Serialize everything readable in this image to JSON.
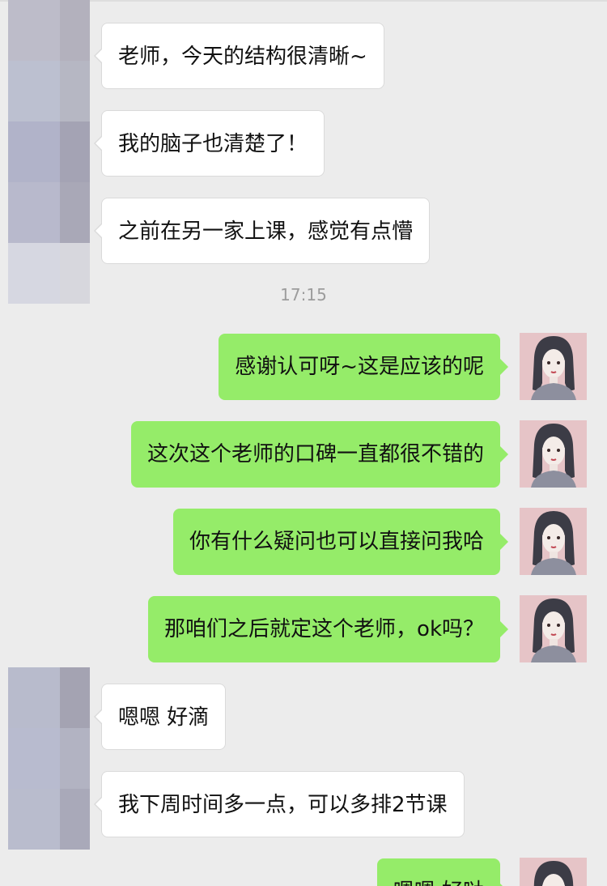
{
  "colors": {
    "background": "#ececec",
    "incoming_bubble": "#ffffff",
    "outgoing_bubble": "#95ec69",
    "timestamp_text": "#9c9c9c"
  },
  "left_avatar_icon": "blurred-avatar-icon",
  "right_avatar_icon": "girl-with-braids-avatar-icon",
  "messages": [
    {
      "side": "left",
      "text": "老师，今天的结构很清晰~"
    },
    {
      "side": "left",
      "text": "我的脑子也清楚了！"
    },
    {
      "side": "left",
      "text": "之前在另一家上课，感觉有点懵"
    },
    {
      "side": "right",
      "text": "感谢认可呀~这是应该的呢"
    },
    {
      "side": "right",
      "text": "这次这个老师的口碑一直都很不错的"
    },
    {
      "side": "right",
      "text": "你有什么疑问也可以直接问我哈"
    },
    {
      "side": "right",
      "text": "那咱们之后就定这个老师，ok吗？"
    },
    {
      "side": "left",
      "text": "嗯嗯 好滴"
    },
    {
      "side": "left",
      "text": "我下周时间多一点，可以多排2节课"
    },
    {
      "side": "right",
      "text": "嗯嗯 好哒"
    }
  ],
  "timestamp": "17:15"
}
